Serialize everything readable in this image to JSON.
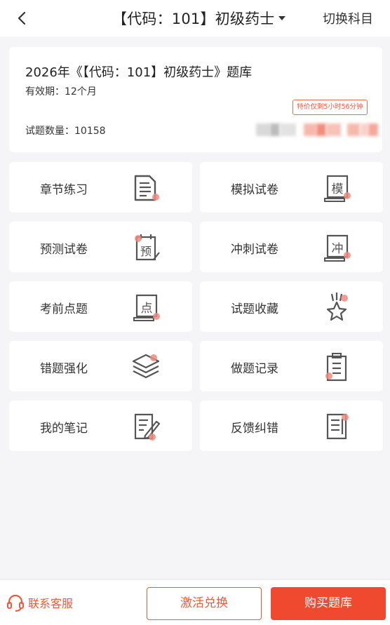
{
  "header": {
    "title": "【代码：101】初级药士",
    "switch_label": "切换科目"
  },
  "info": {
    "bank_name": "2026年《【代码：101】初级药士》题库",
    "validity": "有效期：12个月",
    "question_count": "试题数量：10158",
    "promo": "特价仅剩5小时56分钟"
  },
  "menu": [
    {
      "label": "章节练习",
      "icon": "document-lines-icon"
    },
    {
      "label": "模拟试卷",
      "icon": "mock-scroll-icon"
    },
    {
      "label": "预测试卷",
      "icon": "forecast-calendar-icon"
    },
    {
      "label": "冲刺试卷",
      "icon": "sprint-scroll-icon"
    },
    {
      "label": "考前点题",
      "icon": "point-scroll-icon"
    },
    {
      "label": "试题收藏",
      "icon": "star-medal-icon"
    },
    {
      "label": "错题强化",
      "icon": "layers-icon"
    },
    {
      "label": "做题记录",
      "icon": "clipboard-icon"
    },
    {
      "label": "我的笔记",
      "icon": "note-pencil-icon"
    },
    {
      "label": "反馈纠错",
      "icon": "feedback-list-icon"
    }
  ],
  "footer": {
    "service_label": "联系客服",
    "activate_label": "激活兑换",
    "buy_label": "购买题库"
  },
  "colors": {
    "accent": "#ef4a30",
    "accent_text": "#ee5a3b",
    "icon_dot": "#f08a7e",
    "icon_stroke": "#555555"
  }
}
